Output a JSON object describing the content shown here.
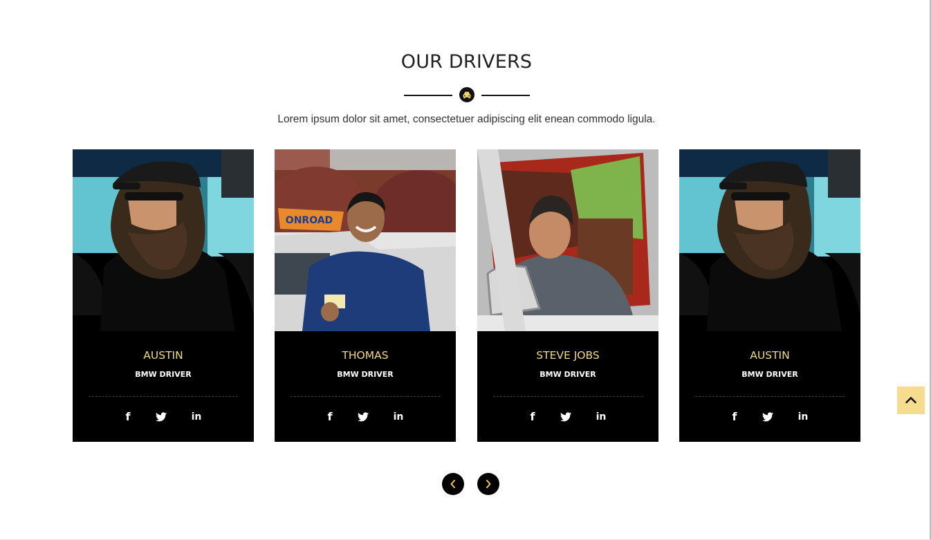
{
  "section": {
    "title": "OUR DRIVERS",
    "subtitle": "Lorem ipsum dolor sit amet, consectetuer adipiscing elit enean commodo ligula."
  },
  "drivers": [
    {
      "name": "AUSTIN",
      "role": "BMW DRIVER",
      "photo": "bearded man in cap and sunglasses beside blue truck"
    },
    {
      "name": "THOMAS",
      "role": "BMW DRIVER",
      "photo": "smiling man holding licence card beside driving-school car"
    },
    {
      "name": "STEVE JOBS",
      "role": "BMW DRIVER",
      "photo": "man sitting in driver seat of red car"
    },
    {
      "name": "AUSTIN",
      "role": "BMW DRIVER",
      "photo": "bearded man in cap and sunglasses beside blue truck"
    }
  ],
  "social_icons": [
    "facebook-icon",
    "twitter-icon",
    "linkedin-icon"
  ],
  "social_glyphs": {
    "facebook": "f",
    "linkedin": "in"
  },
  "carousel": {
    "prev_icon": "chevron-left-icon",
    "next_icon": "chevron-right-icon"
  },
  "scroll_top_icon": "chevron-up-icon",
  "colors": {
    "accent": "#f0d98a",
    "scroll_top_bg": "#f5dc8e",
    "card_bg": "#000000"
  }
}
